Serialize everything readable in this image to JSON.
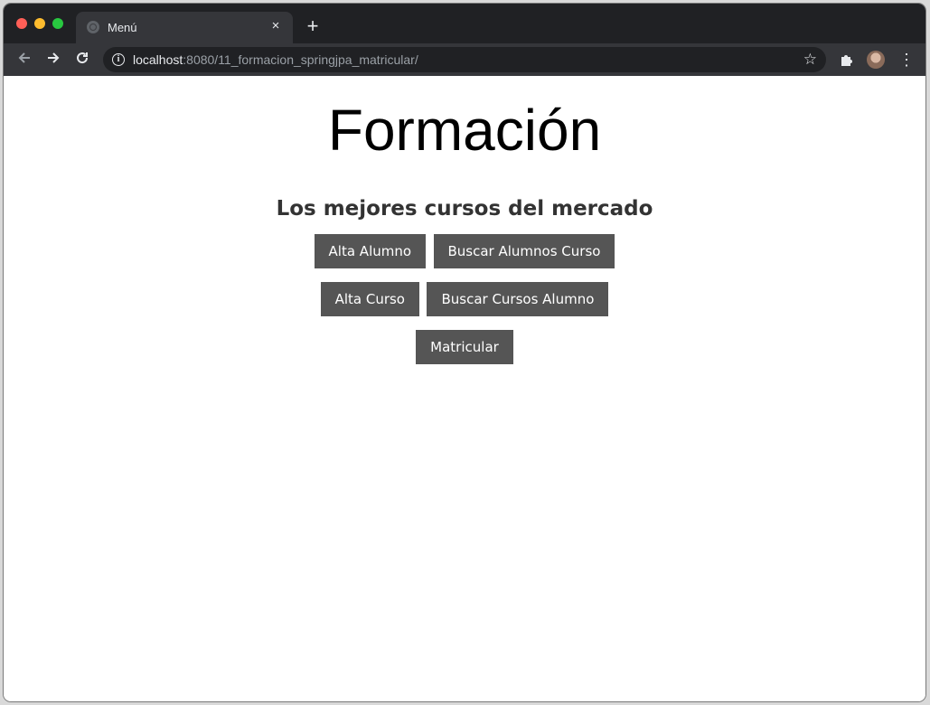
{
  "browser": {
    "tab_title": "Menú",
    "close_glyph": "×",
    "new_tab_glyph": "+",
    "url_host": "localhost",
    "url_rest": ":8080/11_formacion_springjpa_matricular/",
    "icons": [
      "back-icon",
      "forward-icon",
      "reload-icon",
      "info-icon",
      "star-icon",
      "extensions-icon",
      "avatar",
      "menu-icon"
    ]
  },
  "page": {
    "title": "Formación",
    "subtitle": "Los mejores cursos del mercado",
    "buttons": [
      {
        "label": "Alta Alumno"
      },
      {
        "label": "Buscar Alumnos Curso"
      },
      {
        "label": "Alta Curso"
      },
      {
        "label": "Buscar Cursos Alumno"
      },
      {
        "label": "Matricular"
      }
    ]
  },
  "colors": {
    "button_bg": "#555555",
    "button_text": "#ffffff",
    "browser_frame": "#202124",
    "toolbar": "#35363a"
  }
}
